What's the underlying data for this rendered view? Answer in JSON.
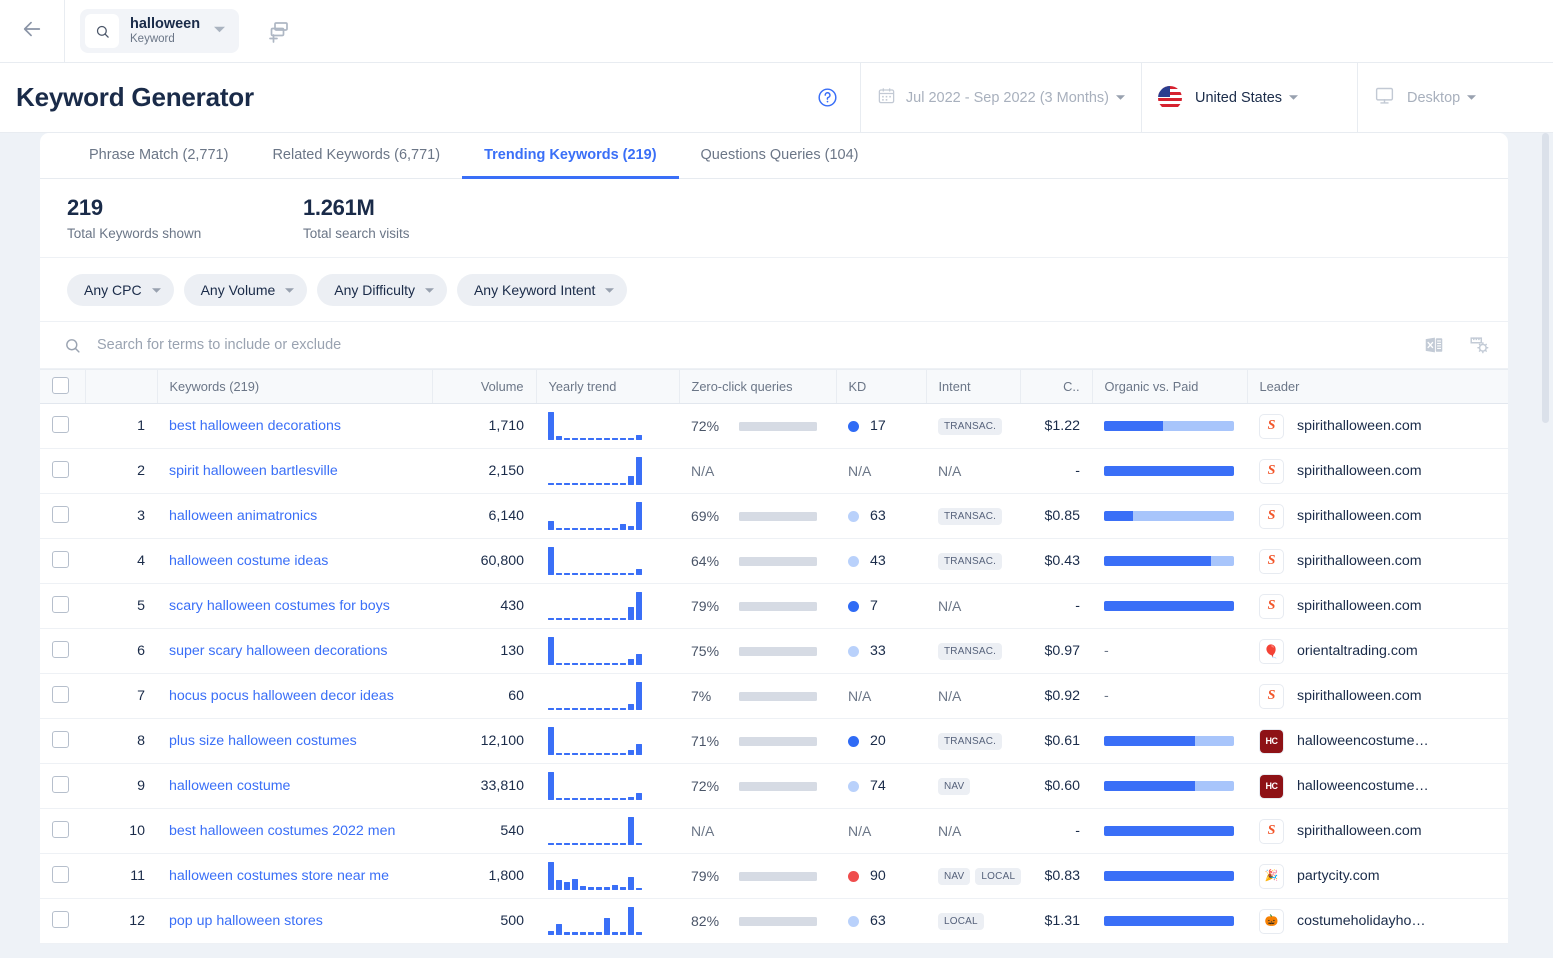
{
  "topbar": {
    "back_icon": "arrow-left-icon",
    "keyword_chip": {
      "title": "halloween",
      "subtitle": "Keyword",
      "search_icon": "search-icon",
      "caret_icon": "chevron-down-icon"
    },
    "add_tab_icon": "add-tab-icon"
  },
  "header": {
    "title": "Keyword Generator",
    "help_icon": "help-circle-icon",
    "date_range": "Jul 2022 - Sep 2022 (3 Months)",
    "calendar_icon": "calendar-icon",
    "country": "United States",
    "country_flag_icon": "us-flag-icon",
    "device": "Desktop",
    "device_icon": "desktop-icon"
  },
  "tabs": [
    {
      "label": "Phrase Match (2,771)",
      "active": false
    },
    {
      "label": "Related Keywords (6,771)",
      "active": false
    },
    {
      "label": "Trending Keywords (219)",
      "active": true
    },
    {
      "label": "Questions Queries (104)",
      "active": false
    }
  ],
  "stats": [
    {
      "value": "219",
      "label": "Total Keywords shown"
    },
    {
      "value": "1.261M",
      "label": "Total search visits"
    }
  ],
  "filters": [
    {
      "label": "Any CPC"
    },
    {
      "label": "Any Volume"
    },
    {
      "label": "Any Difficulty"
    },
    {
      "label": "Any Keyword Intent"
    }
  ],
  "search": {
    "placeholder": "Search for terms to include or exclude",
    "icon": "search-icon"
  },
  "table_actions": [
    {
      "name": "export-excel-icon",
      "label": "Export to Excel"
    },
    {
      "name": "column-settings-icon",
      "label": "Column settings"
    }
  ],
  "colors": {
    "accent": "#3a6ff7",
    "paid": "#a8c5fb",
    "track": "#d6dbe4",
    "kd_easy": "#2f6bf5",
    "kd_medium": "#b9d1fb",
    "kd_hard": "#ef4d4d",
    "title": "#1a2b49"
  },
  "table": {
    "columns": [
      {
        "key": "checkbox",
        "label": "",
        "align": "left"
      },
      {
        "key": "index",
        "label": "",
        "align": "right"
      },
      {
        "key": "keyword",
        "label": "Keywords (219)",
        "align": "left"
      },
      {
        "key": "volume",
        "label": "Volume",
        "align": "right"
      },
      {
        "key": "trend",
        "label": "Yearly trend",
        "align": "left"
      },
      {
        "key": "zeroclick",
        "label": "Zero-click queries",
        "align": "left"
      },
      {
        "key": "kd",
        "label": "KD",
        "align": "left"
      },
      {
        "key": "intent",
        "label": "Intent",
        "align": "left"
      },
      {
        "key": "cpc",
        "label": "C..",
        "align": "right"
      },
      {
        "key": "organic_paid",
        "label": "Organic vs. Paid",
        "align": "left"
      },
      {
        "key": "leader",
        "label": "Leader",
        "align": "left"
      }
    ],
    "rows": [
      {
        "index": "1",
        "keyword": "best halloween decorations",
        "volume": "1,710",
        "trend": [
          100,
          14,
          7,
          7,
          7,
          7,
          7,
          7,
          7,
          7,
          7,
          17
        ],
        "zeroclick": "72%",
        "zeroclick_pct": 72,
        "kd": "17",
        "kd_level": "easy",
        "intent": [
          "TRANSAC."
        ],
        "cpc": "$1.22",
        "organic": 45,
        "paid": 55,
        "leader": "spirithalloween.com",
        "favicon": "spirit-halloween-favicon"
      },
      {
        "index": "2",
        "keyword": "spirit halloween bartlesville",
        "volume": "2,150",
        "trend": [
          5,
          5,
          5,
          5,
          5,
          5,
          5,
          5,
          5,
          5,
          32,
          100
        ],
        "zeroclick": "N/A",
        "zeroclick_pct": null,
        "kd": "N/A",
        "kd_level": null,
        "intent": [],
        "cpc": "-",
        "organic": 100,
        "paid": 0,
        "leader": "spirithalloween.com",
        "favicon": "spirit-halloween-favicon"
      },
      {
        "index": "3",
        "keyword": "halloween animatronics",
        "volume": "6,140",
        "trend": [
          32,
          7,
          7,
          7,
          7,
          7,
          7,
          7,
          7,
          20,
          14,
          100
        ],
        "zeroclick": "69%",
        "zeroclick_pct": 69,
        "kd": "63",
        "kd_level": "medium",
        "intent": [
          "TRANSAC."
        ],
        "cpc": "$0.85",
        "organic": 22,
        "paid": 78,
        "leader": "spirithalloween.com",
        "favicon": "spirit-halloween-favicon"
      },
      {
        "index": "4",
        "keyword": "halloween costume ideas",
        "volume": "60,800",
        "trend": [
          100,
          7,
          7,
          7,
          7,
          7,
          7,
          7,
          7,
          7,
          7,
          22
        ],
        "zeroclick": "64%",
        "zeroclick_pct": 64,
        "kd": "43",
        "kd_level": "medium",
        "intent": [
          "TRANSAC."
        ],
        "cpc": "$0.43",
        "organic": 82,
        "paid": 18,
        "leader": "spirithalloween.com",
        "favicon": "spirit-halloween-favicon"
      },
      {
        "index": "5",
        "keyword": "scary halloween costumes for boys",
        "volume": "430",
        "trend": [
          5,
          5,
          5,
          5,
          5,
          5,
          5,
          5,
          5,
          5,
          48,
          100
        ],
        "zeroclick": "79%",
        "zeroclick_pct": 79,
        "kd": "7",
        "kd_level": "easy",
        "intent": [],
        "cpc": "-",
        "organic": 100,
        "paid": 0,
        "leader": "spirithalloween.com",
        "favicon": "spirit-halloween-favicon"
      },
      {
        "index": "6",
        "keyword": "super scary halloween decorations",
        "volume": "130",
        "trend": [
          100,
          7,
          7,
          7,
          7,
          7,
          7,
          7,
          7,
          7,
          22,
          40
        ],
        "zeroclick": "75%",
        "zeroclick_pct": 75,
        "kd": "33",
        "kd_level": "medium",
        "intent": [
          "TRANSAC."
        ],
        "cpc": "$0.97",
        "organic": null,
        "paid": null,
        "leader": "orientaltrading.com",
        "favicon": "oriental-trading-favicon"
      },
      {
        "index": "7",
        "keyword": "hocus pocus halloween decor ideas",
        "volume": "60",
        "trend": [
          5,
          5,
          5,
          5,
          5,
          5,
          5,
          5,
          5,
          5,
          20,
          100
        ],
        "zeroclick": "7%",
        "zeroclick_pct": 7,
        "kd": "N/A",
        "kd_level": null,
        "intent": [],
        "cpc": "$0.92",
        "organic": null,
        "paid": null,
        "leader": "spirithalloween.com",
        "favicon": "spirit-halloween-favicon"
      },
      {
        "index": "8",
        "keyword": "plus size halloween costumes",
        "volume": "12,100",
        "trend": [
          100,
          7,
          7,
          7,
          7,
          7,
          7,
          7,
          7,
          7,
          18,
          40
        ],
        "zeroclick": "71%",
        "zeroclick_pct": 71,
        "kd": "20",
        "kd_level": "easy",
        "intent": [
          "TRANSAC."
        ],
        "cpc": "$0.61",
        "organic": 70,
        "paid": 30,
        "leader": "halloweencostume…",
        "favicon": "halloween-costumes-favicon"
      },
      {
        "index": "9",
        "keyword": "halloween costume",
        "volume": "33,810",
        "trend": [
          100,
          7,
          7,
          7,
          7,
          7,
          7,
          7,
          7,
          7,
          12,
          25
        ],
        "zeroclick": "72%",
        "zeroclick_pct": 72,
        "kd": "74",
        "kd_level": "medium",
        "intent": [
          "NAV"
        ],
        "cpc": "$0.60",
        "organic": 70,
        "paid": 30,
        "leader": "halloweencostume…",
        "favicon": "halloween-costumes-favicon"
      },
      {
        "index": "10",
        "keyword": "best halloween costumes 2022 men",
        "volume": "540",
        "trend": [
          5,
          5,
          5,
          5,
          5,
          5,
          5,
          5,
          5,
          5,
          100,
          7
        ],
        "zeroclick": "N/A",
        "zeroclick_pct": null,
        "kd": "N/A",
        "kd_level": null,
        "intent": [],
        "cpc": "-",
        "organic": 100,
        "paid": 0,
        "leader": "spirithalloween.com",
        "favicon": "spirit-halloween-favicon"
      },
      {
        "index": "11",
        "keyword": "halloween costumes store near me",
        "volume": "1,800",
        "trend": [
          100,
          35,
          28,
          40,
          14,
          10,
          10,
          10,
          18,
          10,
          45,
          8
        ],
        "zeroclick": "79%",
        "zeroclick_pct": 79,
        "kd": "90",
        "kd_level": "hard",
        "intent": [
          "NAV",
          "LOCAL"
        ],
        "cpc": "$0.83",
        "organic": 100,
        "paid": 0,
        "leader": "partycity.com",
        "favicon": "party-city-favicon"
      },
      {
        "index": "12",
        "keyword": "pop up halloween stores",
        "volume": "500",
        "trend": [
          14,
          40,
          10,
          10,
          10,
          10,
          10,
          62,
          10,
          10,
          100,
          10
        ],
        "zeroclick": "82%",
        "zeroclick_pct": 82,
        "kd": "63",
        "kd_level": "medium",
        "intent": [
          "LOCAL"
        ],
        "cpc": "$1.31",
        "organic": 100,
        "paid": 0,
        "leader": "costumeholidayho…",
        "favicon": "costume-holiday-favicon"
      }
    ]
  }
}
